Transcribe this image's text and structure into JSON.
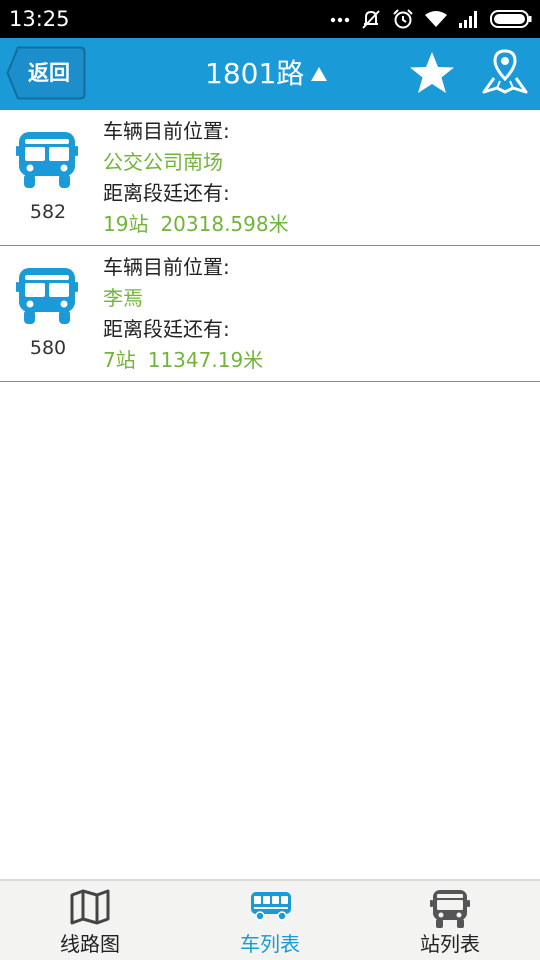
{
  "status_bar": {
    "time": "13:25",
    "icons": [
      "more-dots-icon",
      "mute-icon",
      "alarm-icon",
      "wifi-icon",
      "signal-icon",
      "battery-icon"
    ]
  },
  "header": {
    "back_label": "返回",
    "route_title": "1801路",
    "route_toggle_icon": "triangle-up-icon",
    "favorite_icon": "star-icon",
    "map_icon": "map-pin-icon",
    "background_color": "#1a9ad6"
  },
  "buses": [
    {
      "number": "582",
      "location_label": "车辆目前位置:",
      "location": "公交公司南场",
      "distance_label": "距离段廷还有:",
      "stops": "19站",
      "distance": "20318.598米"
    },
    {
      "number": "580",
      "location_label": "车辆目前位置:",
      "location": "李焉",
      "distance_label": "距离段廷还有:",
      "stops": "7站",
      "distance": "11347.19米"
    }
  ],
  "colors": {
    "accent": "#1a9ad6",
    "highlight_text": "#72b43a"
  },
  "tabs": [
    {
      "label": "线路图",
      "icon": "map-icon",
      "active": false
    },
    {
      "label": "车列表",
      "icon": "bus-side-icon",
      "active": true
    },
    {
      "label": "站列表",
      "icon": "bus-front-icon",
      "active": false
    }
  ]
}
